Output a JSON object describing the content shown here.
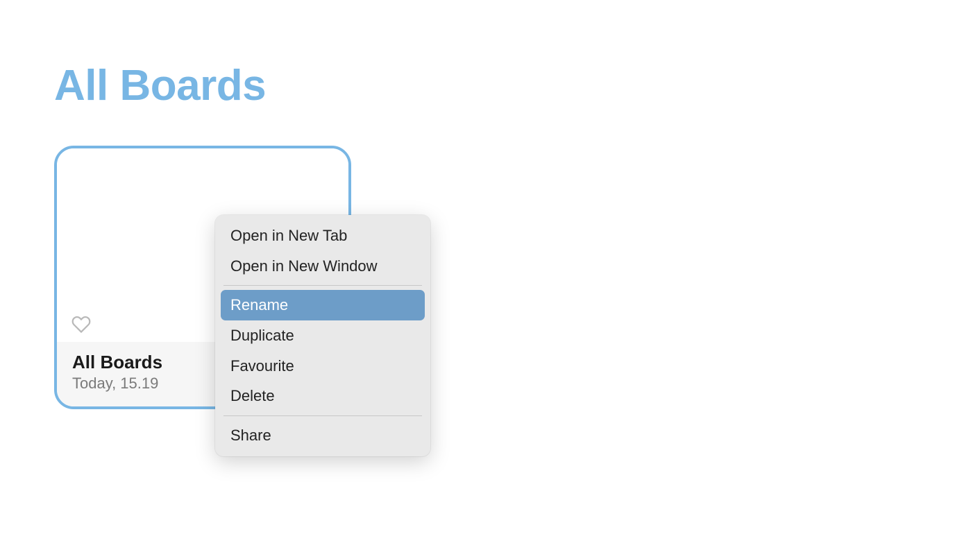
{
  "page": {
    "title": "All Boards"
  },
  "board": {
    "name": "All Boards",
    "date": "Today, 15.19"
  },
  "context_menu": {
    "groups": [
      [
        {
          "label": "Open in New Tab",
          "highlighted": false
        },
        {
          "label": "Open in New Window",
          "highlighted": false
        }
      ],
      [
        {
          "label": "Rename",
          "highlighted": true
        },
        {
          "label": "Duplicate",
          "highlighted": false
        },
        {
          "label": "Favourite",
          "highlighted": false
        },
        {
          "label": "Delete",
          "highlighted": false
        }
      ],
      [
        {
          "label": "Share",
          "highlighted": false
        }
      ]
    ]
  }
}
